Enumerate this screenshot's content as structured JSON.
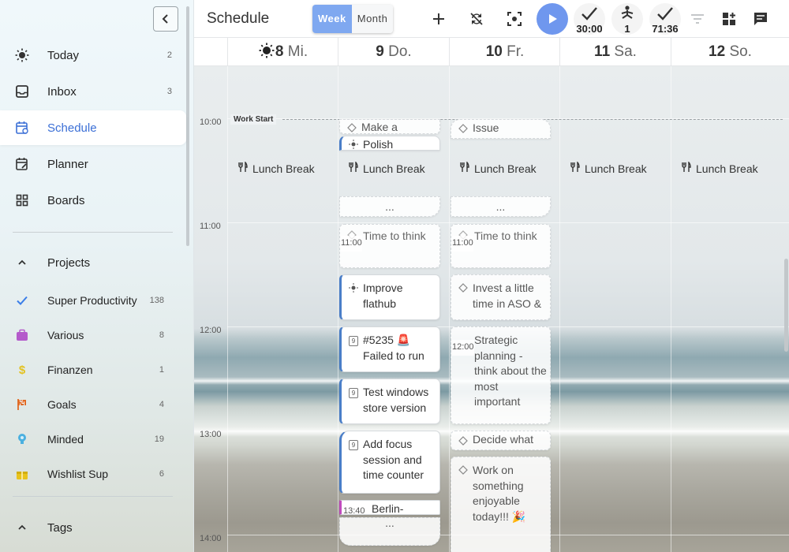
{
  "sidebar": {
    "nav": [
      {
        "label": "Today",
        "count": "2",
        "icon": "sun-icon"
      },
      {
        "label": "Inbox",
        "count": "3",
        "icon": "inbox-icon"
      },
      {
        "label": "Schedule",
        "count": "",
        "icon": "calendar-schedule-icon"
      },
      {
        "label": "Planner",
        "count": "",
        "icon": "calendar-edit-icon"
      },
      {
        "label": "Boards",
        "count": "",
        "icon": "grid-icon"
      }
    ],
    "projects_header": "Projects",
    "projects": [
      {
        "label": "Super Productivity",
        "count": "138",
        "color": "#3b7ee8",
        "icon": "check-icon"
      },
      {
        "label": "Various",
        "count": "8",
        "color": "#b45acb",
        "icon": "briefcase-icon"
      },
      {
        "label": "Finanzen",
        "count": "1",
        "color": "#e3c221",
        "icon": "dollar-icon"
      },
      {
        "label": "Goals",
        "count": "4",
        "color": "#e06a24",
        "icon": "flag-icon"
      },
      {
        "label": "Minded",
        "count": "19",
        "color": "#4bb0e0",
        "icon": "lightbulb-icon"
      },
      {
        "label": "Wishlist Sup",
        "count": "6",
        "color": "#e8c31d",
        "icon": "gift-icon"
      }
    ],
    "tags_header": "Tags"
  },
  "header": {
    "title": "Schedule",
    "view_week": "Week",
    "view_month": "Month",
    "metric_focus": "30:00",
    "metric_breaks": "1",
    "metric_worked": "71:36",
    "accent": "#6f97ee"
  },
  "days": [
    {
      "num": "8",
      "name": "Mi."
    },
    {
      "num": "9",
      "name": "Do."
    },
    {
      "num": "10",
      "name": "Fr."
    },
    {
      "num": "11",
      "name": "Sa."
    },
    {
      "num": "12",
      "name": "So."
    }
  ],
  "times": [
    "10:00",
    "11:00",
    "12:00",
    "13:00",
    "14:00"
  ],
  "work_start": "Work Start",
  "lunch_label": "Lunch Break",
  "more": "...",
  "tasks": {
    "thu": {
      "make": "Make a",
      "polish": "Polish",
      "think": "Time to think",
      "think_time": "11:00",
      "improve": "Improve flathub",
      "issue5235": "#5235 🚨 Failed to run",
      "windows": "Test windows store version",
      "focus": "Add focus session and time counter",
      "berlin": "Berlin-",
      "berlin_time": "13:40"
    },
    "fri": {
      "issue": "Issue",
      "think": "Time to think",
      "think_time": "11:00",
      "aso": "Invest a little time in ASO &",
      "strategic": "Strategic planning - think about the most important",
      "strategic_time": "12:00",
      "decide": "Decide what",
      "enjoyable": "Work on something enjoyable today!!! 🎉"
    }
  }
}
